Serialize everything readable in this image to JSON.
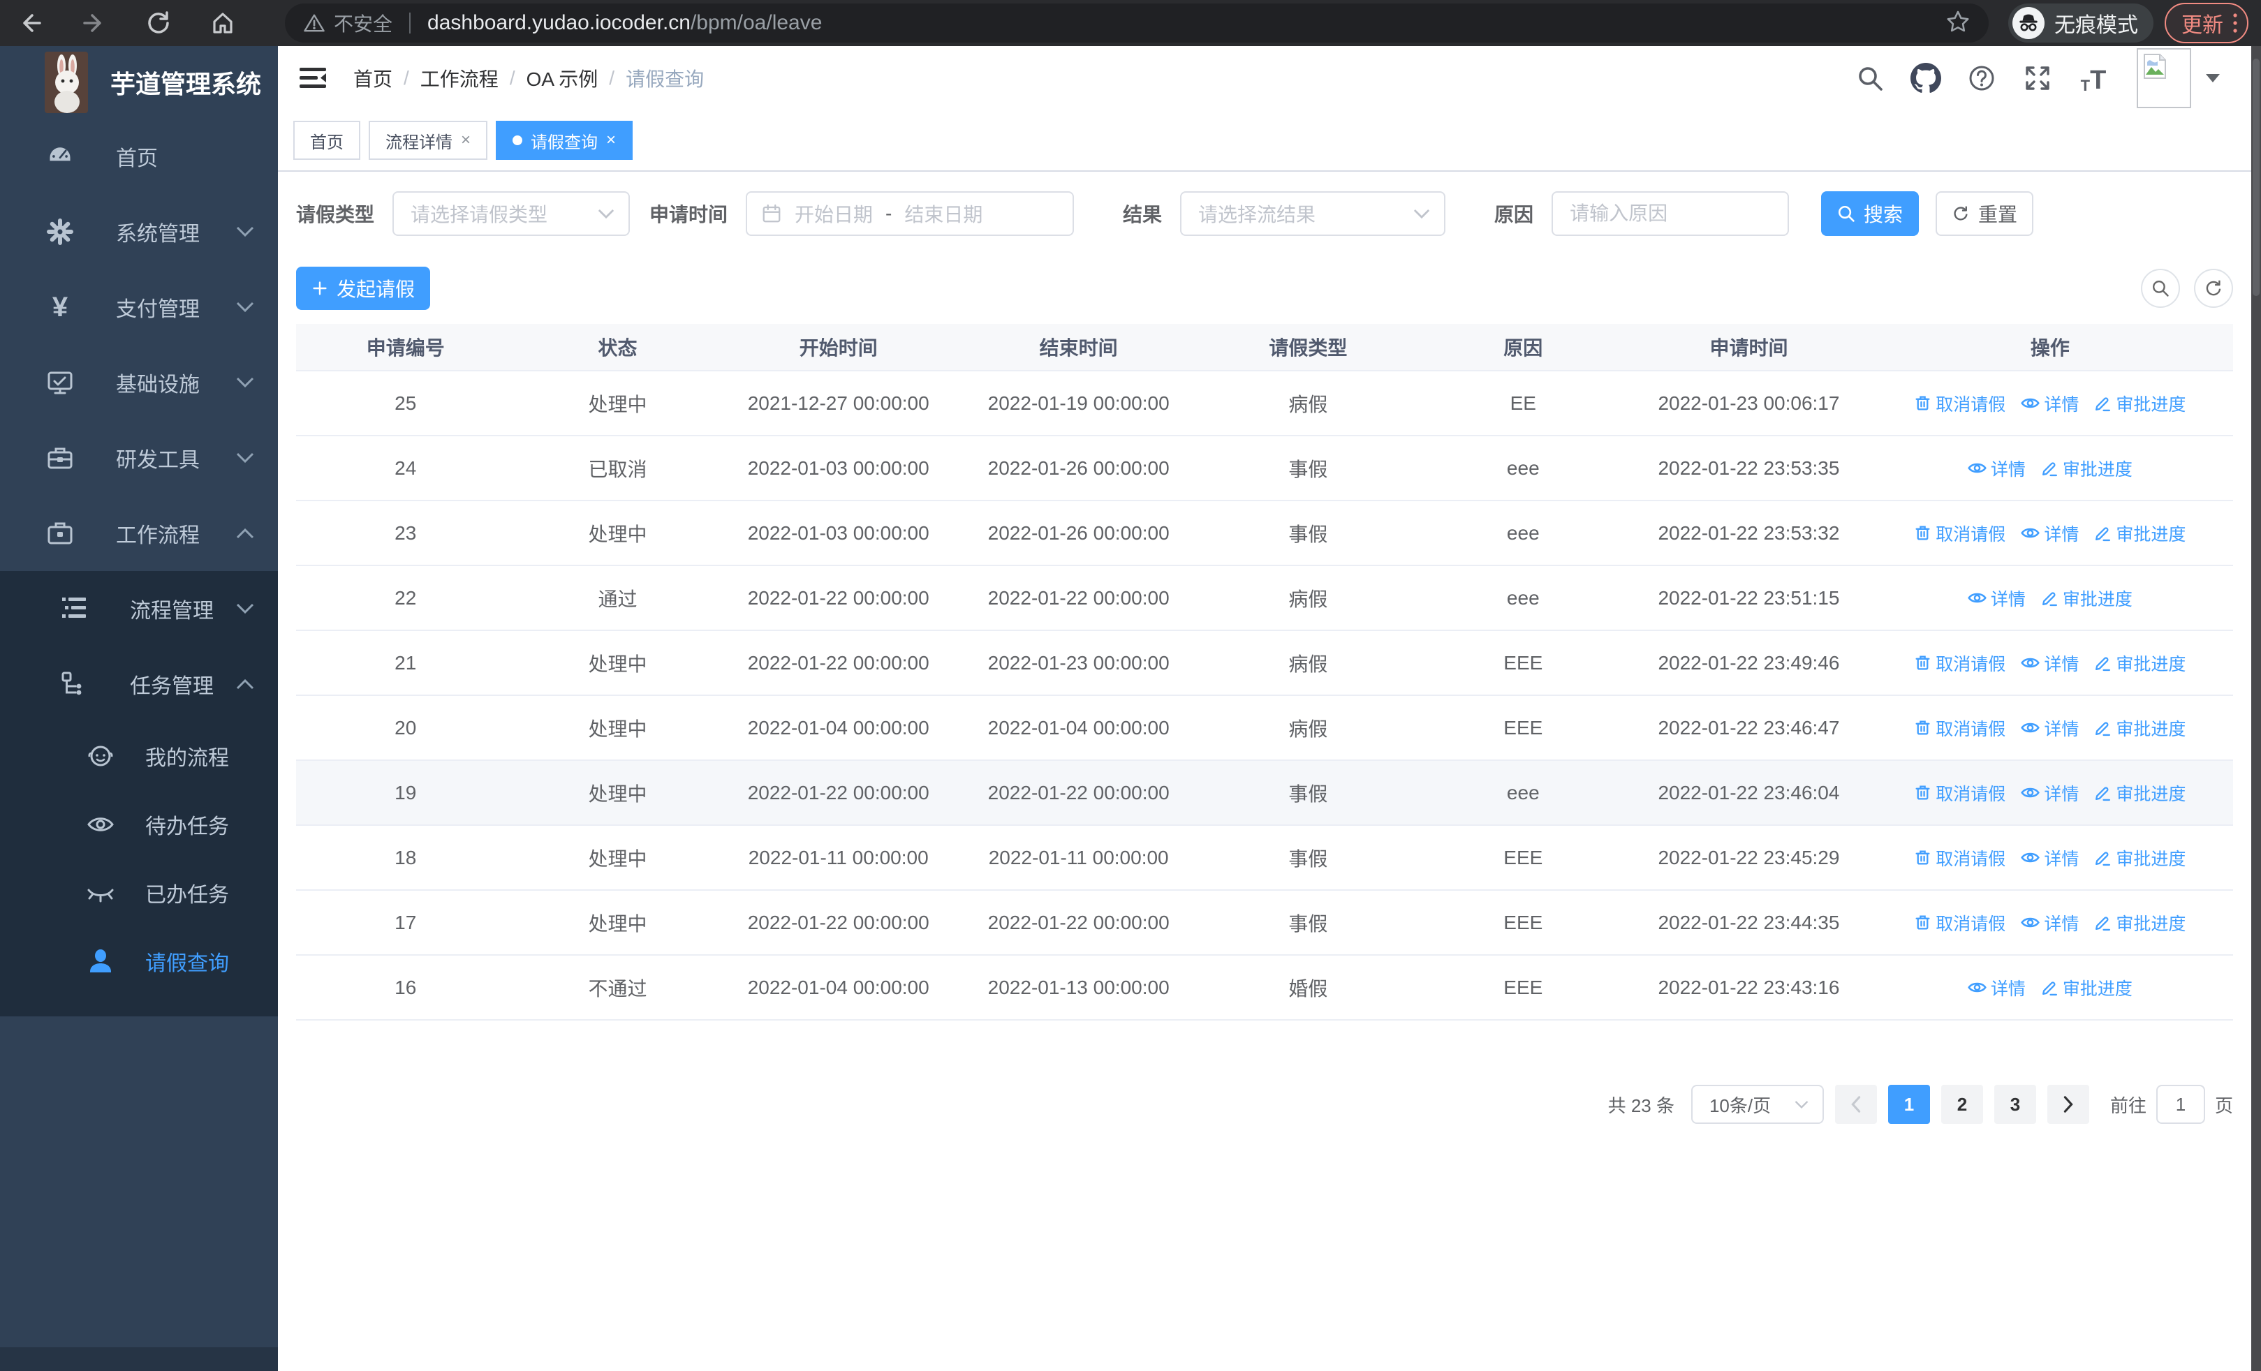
{
  "browser": {
    "security_label": "不安全",
    "url_host": "dashboard.yudao.iocoder.cn",
    "url_path": "/bpm/oa/leave",
    "incognito_label": "无痕模式",
    "update_label": "更新"
  },
  "app": {
    "title": "芋道管理系统"
  },
  "sidebar": {
    "items": [
      {
        "key": "home",
        "label": "首页",
        "icon": "dashboard-icon"
      },
      {
        "key": "system",
        "label": "系统管理",
        "icon": "gear-icon",
        "chevron": "down"
      },
      {
        "key": "payment",
        "label": "支付管理",
        "icon": "yen-icon",
        "chevron": "down"
      },
      {
        "key": "infra",
        "label": "基础设施",
        "icon": "monitor-icon",
        "chevron": "down"
      },
      {
        "key": "devtools",
        "label": "研发工具",
        "icon": "toolbox-icon",
        "chevron": "down"
      },
      {
        "key": "workflow",
        "label": "工作流程",
        "icon": "briefcase-icon",
        "chevron": "up"
      }
    ],
    "submenu": [
      {
        "key": "process-mgmt",
        "label": "流程管理",
        "icon": "list-icon",
        "chevron": "down",
        "level": 1
      },
      {
        "key": "task-mgmt",
        "label": "任务管理",
        "icon": "tree-icon",
        "chevron": "up",
        "level": 1
      },
      {
        "key": "my-process",
        "label": "我的流程",
        "icon": "user-round-icon",
        "level": 2
      },
      {
        "key": "todo-tasks",
        "label": "待办任务",
        "icon": "eye-open-icon",
        "level": 2
      },
      {
        "key": "done-tasks",
        "label": "已办任务",
        "icon": "eye-closed-icon",
        "level": 2
      },
      {
        "key": "leave-query",
        "label": "请假查询",
        "icon": "person-icon",
        "level": 2,
        "active": true
      }
    ]
  },
  "header": {
    "breadcrumb": [
      "首页",
      "工作流程",
      "OA 示例",
      "请假查询"
    ]
  },
  "tabs": [
    {
      "key": "home",
      "label": "首页",
      "closable": false,
      "active": false
    },
    {
      "key": "process-detail",
      "label": "流程详情",
      "closable": true,
      "active": false
    },
    {
      "key": "leave-query",
      "label": "请假查询",
      "closable": true,
      "active": true
    }
  ],
  "filters": {
    "leave_type_label": "请假类型",
    "leave_type_placeholder": "请选择请假类型",
    "apply_time_label": "申请时间",
    "start_placeholder": "开始日期",
    "range_separator": "-",
    "end_placeholder": "结束日期",
    "result_label": "结果",
    "result_placeholder": "请选择流结果",
    "reason_label": "原因",
    "reason_placeholder": "请输入原因",
    "search_label": "搜索",
    "reset_label": "重置"
  },
  "toolbar": {
    "create_label": "发起请假"
  },
  "table": {
    "columns": [
      "申请编号",
      "状态",
      "开始时间",
      "结束时间",
      "请假类型",
      "原因",
      "申请时间",
      "操作"
    ],
    "action_labels": {
      "cancel": "取消请假",
      "detail": "详情",
      "progress": "审批进度"
    },
    "rows": [
      {
        "id": "25",
        "status": "处理中",
        "start": "2021-12-27 00:00:00",
        "end": "2022-01-19 00:00:00",
        "type": "病假",
        "reason": "EE",
        "apply_time": "2022-01-23 00:06:17",
        "actions": [
          "cancel",
          "detail",
          "progress"
        ],
        "highlight": false
      },
      {
        "id": "24",
        "status": "已取消",
        "start": "2022-01-03 00:00:00",
        "end": "2022-01-26 00:00:00",
        "type": "事假",
        "reason": "eee",
        "apply_time": "2022-01-22 23:53:35",
        "actions": [
          "detail",
          "progress"
        ],
        "highlight": false
      },
      {
        "id": "23",
        "status": "处理中",
        "start": "2022-01-03 00:00:00",
        "end": "2022-01-26 00:00:00",
        "type": "事假",
        "reason": "eee",
        "apply_time": "2022-01-22 23:53:32",
        "actions": [
          "cancel",
          "detail",
          "progress"
        ],
        "highlight": false
      },
      {
        "id": "22",
        "status": "通过",
        "start": "2022-01-22 00:00:00",
        "end": "2022-01-22 00:00:00",
        "type": "病假",
        "reason": "eee",
        "apply_time": "2022-01-22 23:51:15",
        "actions": [
          "detail",
          "progress"
        ],
        "highlight": false
      },
      {
        "id": "21",
        "status": "处理中",
        "start": "2022-01-22 00:00:00",
        "end": "2022-01-23 00:00:00",
        "type": "病假",
        "reason": "EEE",
        "apply_time": "2022-01-22 23:49:46",
        "actions": [
          "cancel",
          "detail",
          "progress"
        ],
        "highlight": false
      },
      {
        "id": "20",
        "status": "处理中",
        "start": "2022-01-04 00:00:00",
        "end": "2022-01-04 00:00:00",
        "type": "病假",
        "reason": "EEE",
        "apply_time": "2022-01-22 23:46:47",
        "actions": [
          "cancel",
          "detail",
          "progress"
        ],
        "highlight": false
      },
      {
        "id": "19",
        "status": "处理中",
        "start": "2022-01-22 00:00:00",
        "end": "2022-01-22 00:00:00",
        "type": "事假",
        "reason": "eee",
        "apply_time": "2022-01-22 23:46:04",
        "actions": [
          "cancel",
          "detail",
          "progress"
        ],
        "highlight": true
      },
      {
        "id": "18",
        "status": "处理中",
        "start": "2022-01-11 00:00:00",
        "end": "2022-01-11 00:00:00",
        "type": "事假",
        "reason": "EEE",
        "apply_time": "2022-01-22 23:45:29",
        "actions": [
          "cancel",
          "detail",
          "progress"
        ],
        "highlight": false
      },
      {
        "id": "17",
        "status": "处理中",
        "start": "2022-01-22 00:00:00",
        "end": "2022-01-22 00:00:00",
        "type": "事假",
        "reason": "EEE",
        "apply_time": "2022-01-22 23:44:35",
        "actions": [
          "cancel",
          "detail",
          "progress"
        ],
        "highlight": false
      },
      {
        "id": "16",
        "status": "不通过",
        "start": "2022-01-04 00:00:00",
        "end": "2022-01-13 00:00:00",
        "type": "婚假",
        "reason": "EEE",
        "apply_time": "2022-01-22 23:43:16",
        "actions": [
          "detail",
          "progress"
        ],
        "highlight": false
      }
    ]
  },
  "pagination": {
    "total_label": "共 23 条",
    "page_size_label": "10条/页",
    "pages": [
      "1",
      "2",
      "3"
    ],
    "current_page": "1",
    "goto_label": "前往",
    "goto_value": "1",
    "goto_suffix": "页"
  },
  "colors": {
    "primary": "#409eff",
    "sidebar_bg": "#304156",
    "submenu_bg": "#1f2d3d",
    "update_accent": "#f28b82"
  }
}
